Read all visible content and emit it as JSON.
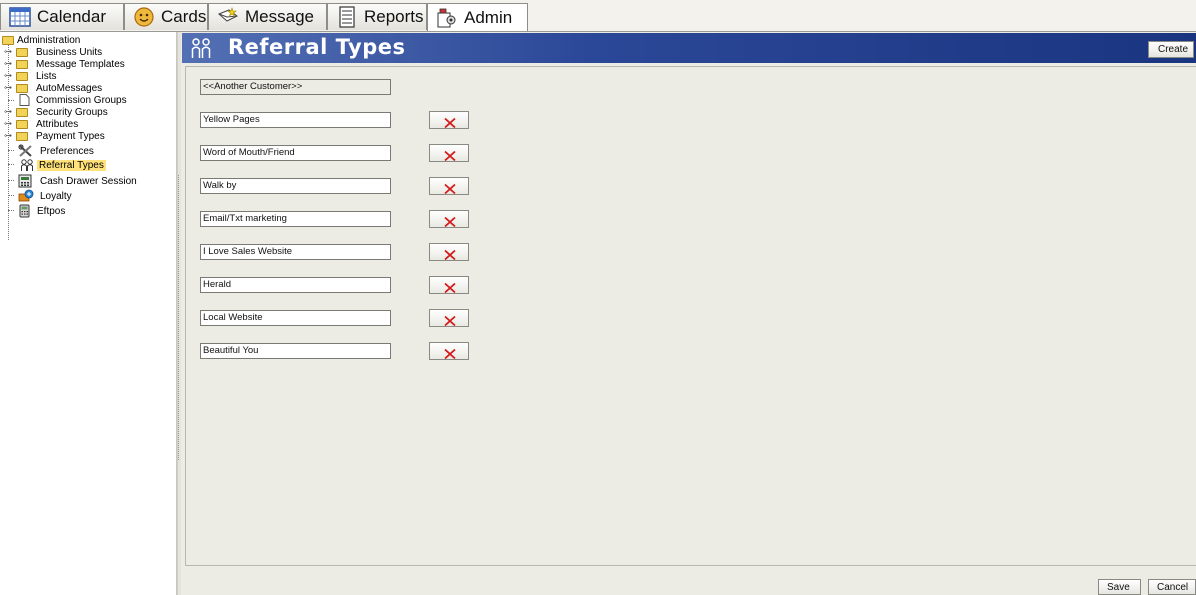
{
  "tabs": [
    {
      "label": "Calendar",
      "icon": "calendar-icon"
    },
    {
      "label": "Cards",
      "icon": "cards-icon"
    },
    {
      "label": "Message",
      "icon": "message-icon"
    },
    {
      "label": "Reports",
      "icon": "reports-icon"
    },
    {
      "label": "Admin",
      "icon": "admin-icon",
      "active": true
    }
  ],
  "tree": {
    "root": "Administration",
    "items": [
      {
        "label": "Business Units",
        "icon": "folder-icon",
        "expandable": true
      },
      {
        "label": "Message Templates",
        "icon": "folder-icon",
        "expandable": true
      },
      {
        "label": "Lists",
        "icon": "folder-icon",
        "expandable": true
      },
      {
        "label": "AutoMessages",
        "icon": "folder-icon",
        "expandable": true
      },
      {
        "label": "Commission Groups",
        "icon": "page-icon",
        "expandable": false
      },
      {
        "label": "Security Groups",
        "icon": "folder-icon",
        "expandable": true
      },
      {
        "label": "Attributes",
        "icon": "folder-icon",
        "expandable": true
      },
      {
        "label": "Payment Types",
        "icon": "folder-icon",
        "expandable": true
      },
      {
        "label": "Preferences",
        "icon": "tools-icon",
        "expandable": false
      },
      {
        "label": "Referral Types",
        "icon": "referral-icon",
        "expandable": false,
        "selected": true
      },
      {
        "label": "Cash Drawer Session",
        "icon": "cash-drawer-icon",
        "expandable": false
      },
      {
        "label": "Loyalty",
        "icon": "loyalty-icon",
        "expandable": false
      },
      {
        "label": "Eftpos",
        "icon": "eftpos-icon",
        "expandable": false
      }
    ]
  },
  "header": {
    "title": "Referral Types",
    "create_label": "Create"
  },
  "referral_types": {
    "fixed": "<<Another Customer>>",
    "items": [
      "Yellow Pages",
      "Word of Mouth/Friend",
      "Walk by",
      "Email/Txt marketing",
      "I Love Sales Website",
      "Herald",
      "Local Website",
      "Beautiful You"
    ]
  },
  "footer": {
    "save_label": "Save",
    "cancel_label": "Cancel"
  },
  "colors": {
    "header_start": "#5470b4",
    "header_end": "#1a3580",
    "delete_x": "#d21a1a",
    "selection": "#ffe27a"
  }
}
